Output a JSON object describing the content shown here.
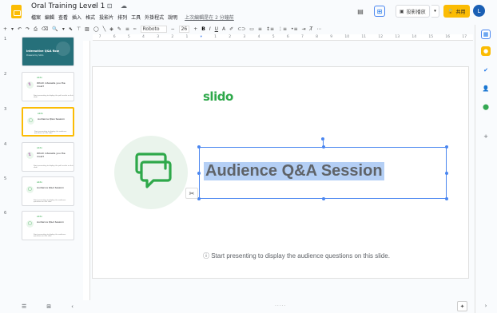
{
  "header": {
    "title": "Oral Training Level 1",
    "title_icons": "☆ ⊡ ☁",
    "menu": [
      "檔案",
      "編輯",
      "查看",
      "插入",
      "格式",
      "投影片",
      "排列",
      "工具",
      "外掛程式",
      "說明"
    ],
    "last_edit": "上次編輯是在 2 分鐘前",
    "present_label": "投影播放",
    "share_label": "共用",
    "avatar_initial": "L"
  },
  "toolbar": {
    "items_left": [
      "+",
      "▾",
      "↶",
      "↷",
      "⎙",
      "⌫",
      "🔍",
      "▾"
    ],
    "font": "Roboto",
    "font_size": "26",
    "bold": "B",
    "italic": "I",
    "underline": "U",
    "color": "A",
    "more": "⋯"
  },
  "ruler": [
    "7",
    "6",
    "5",
    "4",
    "3",
    "2",
    "1",
    "",
    "1",
    "2",
    "3",
    "4",
    "5",
    "6",
    "7",
    "8",
    "9",
    "10",
    "11",
    "12",
    "13",
    "14",
    "15",
    "16",
    "17"
  ],
  "thumbnails": [
    {
      "num": "1",
      "title": "Interactive Q&A flow",
      "sub": "Powered by Slido"
    },
    {
      "num": "2",
      "slido": "slido",
      "text": "Which interests you the most?",
      "foot": "Start presenting to display the poll results on this slide."
    },
    {
      "num": "3",
      "slido": "slido",
      "text": "Audience Q&A Session",
      "foot": "Start presenting to display the audience questions on this slide."
    },
    {
      "num": "4",
      "slido": "slido",
      "text": "Which interests you the most?",
      "foot": "Start presenting to display the poll results on this slide."
    },
    {
      "num": "5",
      "slido": "slido",
      "text": "Audience Q&A Session",
      "foot": "Start presenting to display the audience questions on this slide."
    },
    {
      "num": "6",
      "slido": "slido",
      "text": "Audience Q&A Session",
      "foot": "Start presenting to display the audience questions on this slide."
    }
  ],
  "slide": {
    "logo": "slido",
    "title": "Audience Q&A Session",
    "footnote": "ⓘ Start presenting to display the audience questions on this slide."
  },
  "colors": {
    "brand_yellow": "#fbbc04",
    "slido_green": "#2ea84a",
    "selection_blue": "#4a86f0",
    "highlight": "#b4cff5"
  }
}
